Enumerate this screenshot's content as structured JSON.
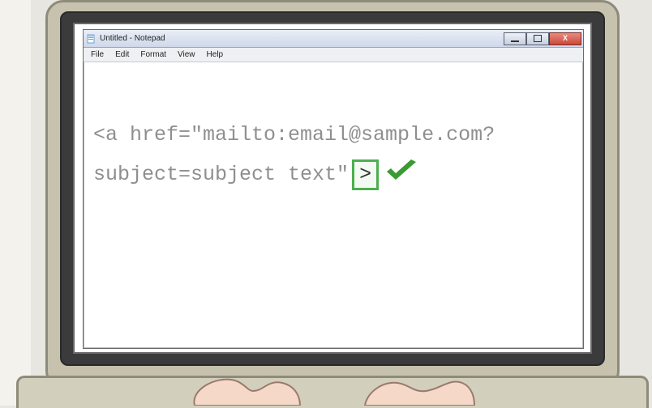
{
  "window": {
    "title": "Untitled - Notepad",
    "icon_name": "notepad-icon"
  },
  "window_controls": {
    "minimize_label": "–",
    "maximize_label": "",
    "close_label": "X"
  },
  "menu": {
    "file": "File",
    "edit": "Edit",
    "format": "Format",
    "view": "View",
    "help": "Help"
  },
  "editor": {
    "line1": "<a href=\"mailto:email@sample.com?",
    "line2_prefix": "subject=subject text\"",
    "highlighted_char": ">",
    "check_name": "checkmark-icon"
  },
  "colors": {
    "code_text": "#8f8f8f",
    "highlight_border": "#4caf50",
    "check_fill": "#3a9a34"
  }
}
